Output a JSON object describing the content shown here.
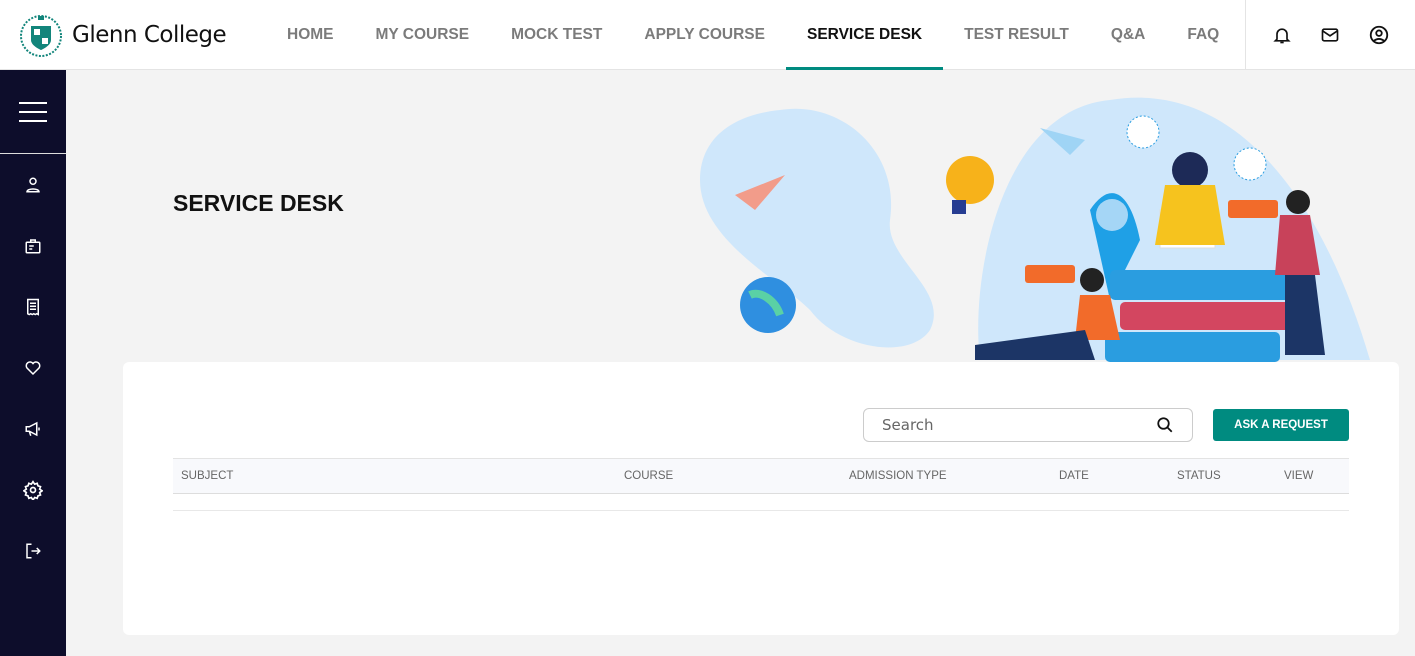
{
  "brand": {
    "name": "Glenn College"
  },
  "nav": [
    {
      "label": "HOME"
    },
    {
      "label": "MY COURSE"
    },
    {
      "label": "MOCK TEST"
    },
    {
      "label": "APPLY COURSE"
    },
    {
      "label": "SERVICE DESK",
      "active": true
    },
    {
      "label": "TEST RESULT"
    },
    {
      "label": "Q&A"
    },
    {
      "label": "FAQ"
    }
  ],
  "header_icons": [
    "bell-icon",
    "mail-icon",
    "user-circle-icon"
  ],
  "sidebar": [
    "user-icon",
    "briefcase-icon",
    "receipt-icon",
    "heart-icon",
    "megaphone-icon",
    "gear-icon",
    "logout-icon"
  ],
  "page": {
    "title": "SERVICE DESK"
  },
  "search": {
    "placeholder": "Search"
  },
  "ask_button": "ASK A REQUEST",
  "table": {
    "columns": [
      "SUBJECT",
      "COURSE",
      "ADMISSION TYPE",
      "DATE",
      "STATUS",
      "VIEW"
    ],
    "rows": []
  },
  "colors": {
    "accent": "#008b80",
    "sidebar": "#0d0d2b"
  }
}
